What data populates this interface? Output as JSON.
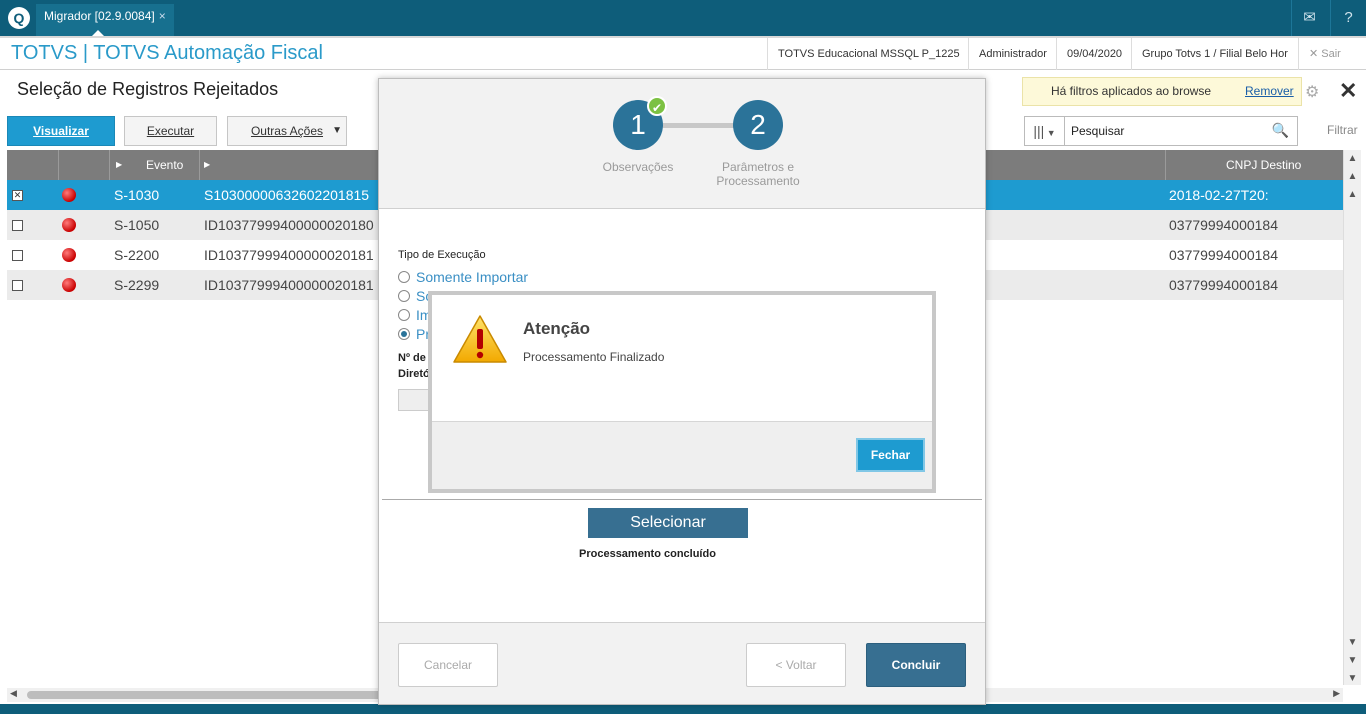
{
  "topbar": {
    "tab_label": "Migrador [02.9.0084]",
    "tab_close": "×",
    "logo_glyph": "Q"
  },
  "header": {
    "app_title": "TOTVS | TOTVS Automação Fiscal",
    "environment": "TOTVS Educacional MSSQL P_1225",
    "user": "Administrador",
    "date": "09/04/2020",
    "branch": "Grupo Totvs 1 / Filial Belo Hor",
    "logout": "Sair"
  },
  "page": {
    "title": "Seleção de Registros Rejeitados"
  },
  "toolbar": {
    "visualizar": "Visualizar",
    "executar": "Executar",
    "outras_acoes": "Outras Ações"
  },
  "filter": {
    "notice": "Há filtros aplicados ao browse",
    "remove": "Remover",
    "search_placeholder": "Pesquisar",
    "filtrar": "Filtrar"
  },
  "grid": {
    "columns": [
      "Evento",
      "CNPJ Destino"
    ],
    "rows": [
      {
        "evento": "S-1030",
        "id": "S10300000632602201815",
        "cnpj": "2018-02-27T20:",
        "checked": true
      },
      {
        "evento": "S-1050",
        "id": "ID10377999400000020180",
        "cnpj": "03779994000184",
        "checked": false
      },
      {
        "evento": "S-2200",
        "id": "ID10377999400000020181",
        "cnpj": "03779994000184",
        "checked": false
      },
      {
        "evento": "S-2299",
        "id": "ID10377999400000020181",
        "cnpj": "03779994000184",
        "checked": false
      }
    ]
  },
  "wizard": {
    "step1_number": "1",
    "step1_label": "Observações",
    "step2_number": "2",
    "step2_label_line1": "Parâmetros e",
    "step2_label_line2": "Processamento",
    "section_label": "Tipo de Execução",
    "options": [
      "Somente Importar",
      "So",
      "Im",
      "Pr"
    ],
    "selected_option_index": 3,
    "label_num": "Nº de",
    "label_dir": "Diretó",
    "select_button": "Selecionar",
    "status": "Processamento concluído",
    "cancel": "Cancelar",
    "back": "< Voltar",
    "finish": "Concluir"
  },
  "alert": {
    "title": "Atenção",
    "message": "Processamento Finalizado",
    "close_button": "Fechar"
  },
  "colors": {
    "topbar": "#0e5d7a",
    "accent": "#1e9bd0",
    "wizard_blue": "#2b7399",
    "error_dot": "#c90000",
    "check_green": "#7cc142"
  }
}
